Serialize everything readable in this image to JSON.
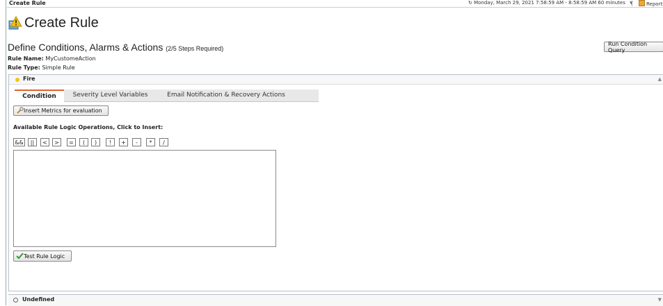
{
  "topbar": {
    "title": "Create Rule",
    "time_range": "↻ Monday, March 29, 2021 7:58:59 AM - 8:58:59 AM 60 minutes",
    "reports_label": "Reports"
  },
  "header": {
    "title": "Create Rule",
    "icon": "rule-warning-icon"
  },
  "section": {
    "title": "Define Conditions, Alarms & Actions",
    "steps": "(2/5 Steps Required)",
    "rule_name_label": "Rule Name:",
    "rule_name_value": "MyCustomeAction",
    "rule_type_label": "Rule Type:",
    "rule_type_value": "Simple Rule",
    "run_query_label": "Run Condition Query"
  },
  "fire_panel": {
    "label": "Fire",
    "dot_color": "#f3c511",
    "tabs": [
      {
        "label": "Condition",
        "active": true
      },
      {
        "label": "Severity Level Variables",
        "active": false
      },
      {
        "label": "Email Notification & Recovery Actions",
        "active": false
      }
    ],
    "insert_metrics_label": "Insert Metrics for evaluation",
    "ops_title": "Available Rule Logic Operations, Click to Insert:",
    "operators": [
      "&&",
      "||",
      "<",
      ">",
      "=",
      "(",
      ")",
      "!",
      "+",
      "-",
      "*",
      "/"
    ],
    "editor_value": "",
    "test_button_label": "Test Rule Logic"
  },
  "undefined_panel": {
    "label": "Undefined"
  },
  "colors": {
    "accent_tab": "#e0622b",
    "check": "#2e9e2e"
  }
}
